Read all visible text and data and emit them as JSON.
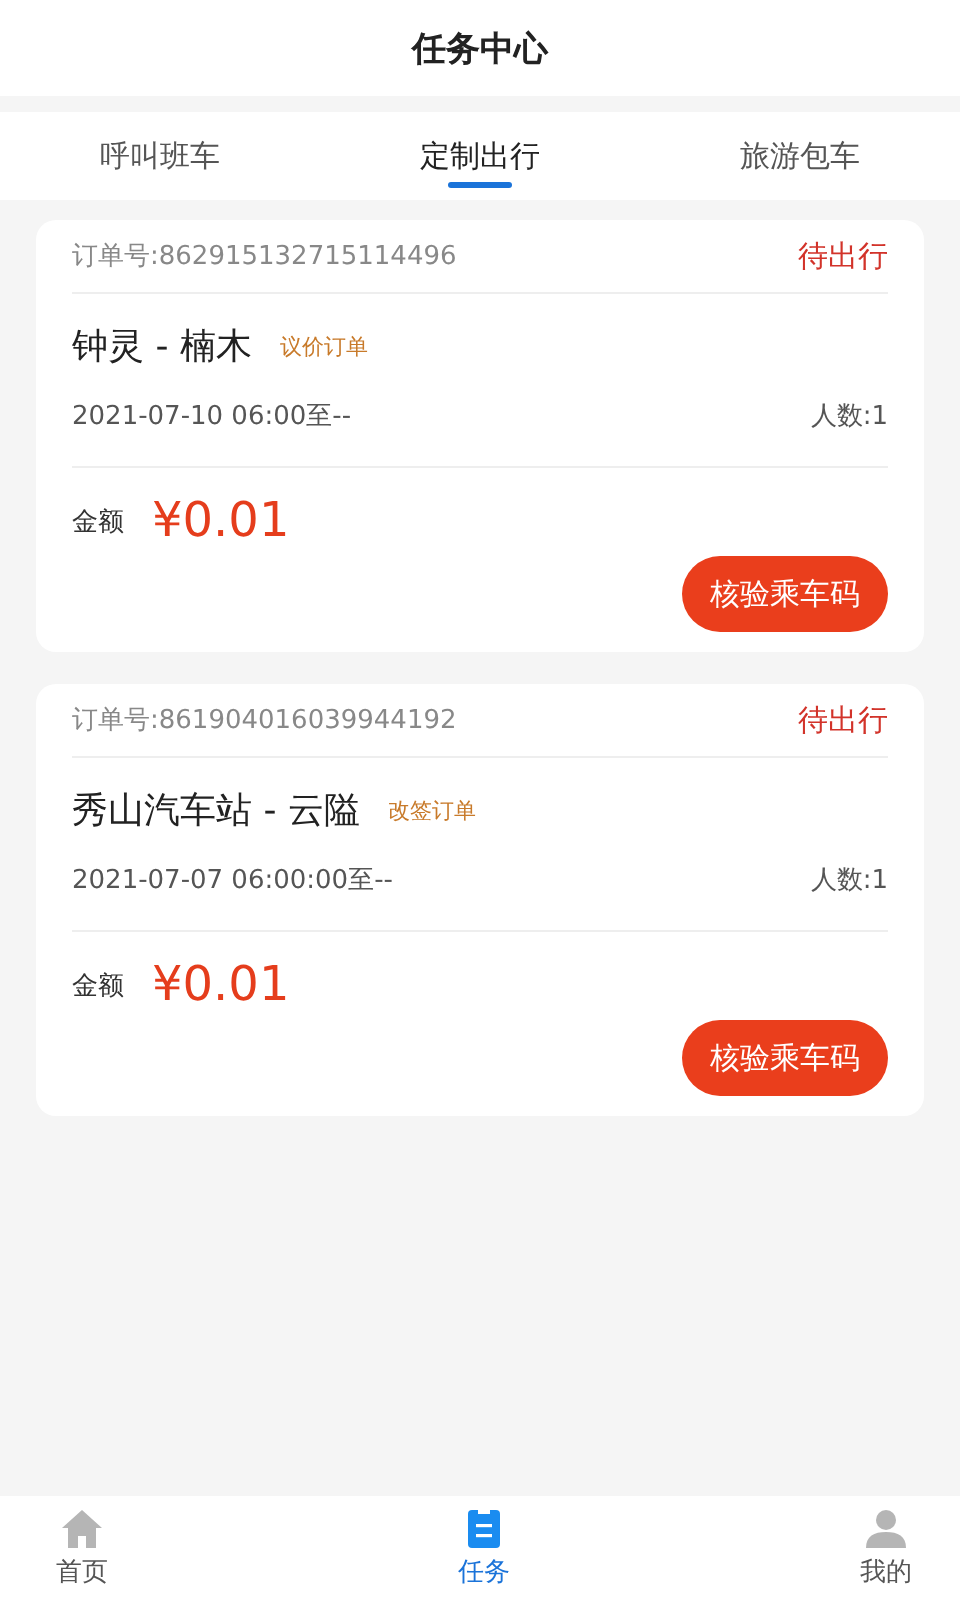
{
  "header": {
    "title": "任务中心"
  },
  "tabs": [
    {
      "label": "呼叫班车",
      "selected": false
    },
    {
      "label": "定制出行",
      "selected": true
    },
    {
      "label": "旅游包车",
      "selected": false
    }
  ],
  "orders": [
    {
      "order_no": "订单号:862915132715114496",
      "status": "待出行",
      "route": "钟灵 - 楠木",
      "tag": "议价订单",
      "time": "2021-07-10 06:00至--",
      "passengers": "人数:1",
      "amount_label": "金额",
      "amount": "¥0.01",
      "action": "核验乘车码"
    },
    {
      "order_no": "订单号:861904016039944192",
      "status": "待出行",
      "route": "秀山汽车站 - 云隘",
      "tag": "改签订单",
      "time": "2021-07-07 06:00:00至--",
      "passengers": "人数:1",
      "amount_label": "金额",
      "amount": "¥0.01",
      "action": "核验乘车码"
    }
  ],
  "bottom_nav": [
    {
      "kind": "home",
      "label": "首页",
      "selected": false
    },
    {
      "kind": "task",
      "label": "任务",
      "selected": true
    },
    {
      "kind": "profile",
      "label": "我的",
      "selected": false
    }
  ]
}
